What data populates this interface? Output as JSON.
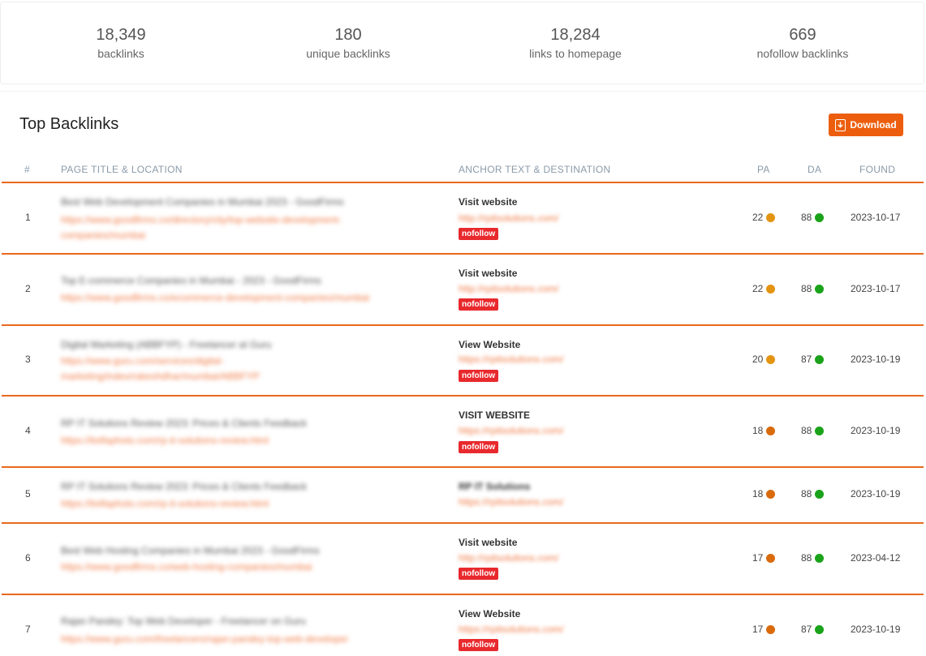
{
  "stats": [
    {
      "value": "18,349",
      "label": "backlinks"
    },
    {
      "value": "180",
      "label": "unique backlinks"
    },
    {
      "value": "18,284",
      "label": "links to homepage"
    },
    {
      "value": "669",
      "label": "nofollow backlinks"
    }
  ],
  "section": {
    "title": "Top Backlinks",
    "download_label": "Download"
  },
  "columns": {
    "num": "#",
    "page": "PAGE TITLE & LOCATION",
    "anchor": "ANCHOR TEXT & DESTINATION",
    "pa": "PA",
    "da": "DA",
    "found": "FOUND"
  },
  "colors": {
    "accent": "#ec5e0d",
    "pa_orange": "#e8901a",
    "pa_dark_orange": "#d96b0c",
    "da_green": "#1aa31a",
    "nofollow": "#e8292d"
  },
  "rows": [
    {
      "num": "1",
      "title": "Best Web Development Companies in Mumbai 2023 - GoodFirms",
      "url": "https://www.goodfirms.co/directory/city/top-website-development-companies/mumbai",
      "anchor": "Visit website",
      "dest": "http://rpitsolutions.com/",
      "nofollow": "nofollow",
      "pa": "22",
      "da": "88",
      "found": "2023-10-17"
    },
    {
      "num": "2",
      "title": "Top E-commerce Companies in Mumbai - 2023 - GoodFirms",
      "url": "https://www.goodfirms.co/ecommerce-development-companies/mumbai",
      "anchor": "Visit website",
      "dest": "http://rpitsolutions.com/",
      "nofollow": "nofollow",
      "pa": "22",
      "da": "88",
      "found": "2023-10-17"
    },
    {
      "num": "3",
      "title": "Digital Marketing (ABBFYP) - Freelancer at Guru",
      "url": "https://www.guru.com/services/digital-marketing/index/rakeshdhar/mumbai/ABBFYP",
      "anchor": "View Website",
      "dest": "https://rpitsolutions.com/",
      "nofollow": "nofollow",
      "pa": "20",
      "da": "87",
      "found": "2023-10-19"
    },
    {
      "num": "4",
      "title": "RP IT Solutions Review 2023: Prices & Clients Feedback",
      "url": "https://listfaphoto.com/rp-it-solutions-review.html",
      "anchor": "VISIT WEBSITE",
      "dest": "https://rpitsolutions.com/",
      "nofollow": "nofollow",
      "pa": "18",
      "da": "88",
      "found": "2023-10-19"
    },
    {
      "num": "5",
      "title": "RP IT Solutions Review 2023: Prices & Clients Feedback",
      "url": "https://listfaphoto.com/rp-it-solutions-review.html",
      "anchor": "RP IT Solutions",
      "dest": "https://rpitsolutions.com/",
      "nofollow": "",
      "pa": "18",
      "da": "88",
      "found": "2023-10-19"
    },
    {
      "num": "6",
      "title": "Best Web Hosting Companies in Mumbai 2023 - GoodFirms",
      "url": "https://www.goodfirms.co/web-hosting-companies/mumbai",
      "anchor": "Visit website",
      "dest": "http://rpitsolutions.com/",
      "nofollow": "nofollow",
      "pa": "17",
      "da": "88",
      "found": "2023-04-12"
    },
    {
      "num": "7",
      "title": "Rajan Pandey: Top Web Developer - Freelancer on Guru",
      "url": "https://www.guru.com/freelancers/rajan-pandey-top-web-developer",
      "anchor": "View Website",
      "dest": "https://rpitsolutions.com/",
      "nofollow": "nofollow",
      "pa": "17",
      "da": "87",
      "found": "2023-10-19"
    }
  ]
}
